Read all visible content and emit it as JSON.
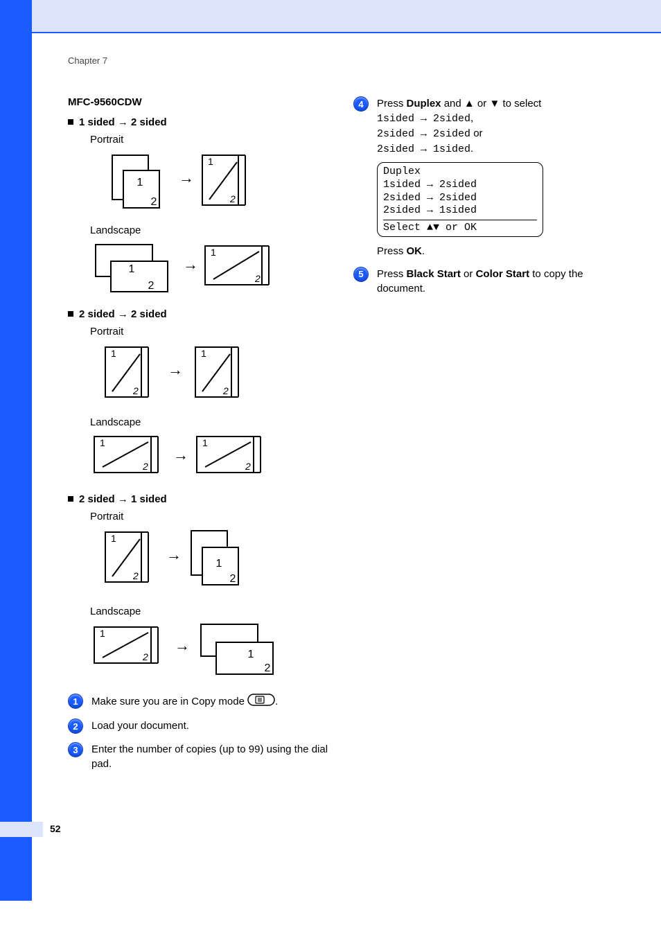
{
  "chapter": "Chapter 7",
  "model": "MFC-9560CDW",
  "modes": {
    "m1": {
      "from": "1 sided",
      "to": "2 sided"
    },
    "m2": {
      "from": "2 sided",
      "to": "2 sided"
    },
    "m3": {
      "from": "2 sided",
      "to": "1 sided"
    }
  },
  "orient": {
    "portrait": "Portrait",
    "landscape": "Landscape"
  },
  "arrow_small": "→",
  "steps": {
    "s1": {
      "num": "1",
      "text": "Make sure you are in Copy mode "
    },
    "s1_tail": ".",
    "s2": {
      "num": "2",
      "text": "Load your document."
    },
    "s3": {
      "num": "3",
      "text": "Enter the number of copies (up to 99) using the dial pad."
    },
    "s4": {
      "num": "4",
      "lead_a": "Press ",
      "bold_duplex": "Duplex",
      "lead_b": " and ",
      "up": "▲",
      "mid": " or ",
      "down": "▼",
      "lead_c": " to select",
      "opt1": "1sided → 2sided",
      "comma": ",",
      "opt2": "2sided → 2sided",
      "or": " or",
      "opt3": "2sided → 1sided",
      "period": ".",
      "press_ok_a": "Press ",
      "press_ok_b": "OK",
      "press_ok_c": "."
    },
    "s5": {
      "num": "5",
      "a": "Press ",
      "b": "Black Start",
      "c": " or ",
      "d": "Color Start",
      "e": " to copy the document."
    }
  },
  "lcd": {
    "title": "Duplex",
    "l1": " 1sided → 2sided",
    "l2": " 2sided → 2sided",
    "l3": " 2sided → 1sided",
    "sel": "Select ▲▼ or OK"
  },
  "page_number": "52"
}
